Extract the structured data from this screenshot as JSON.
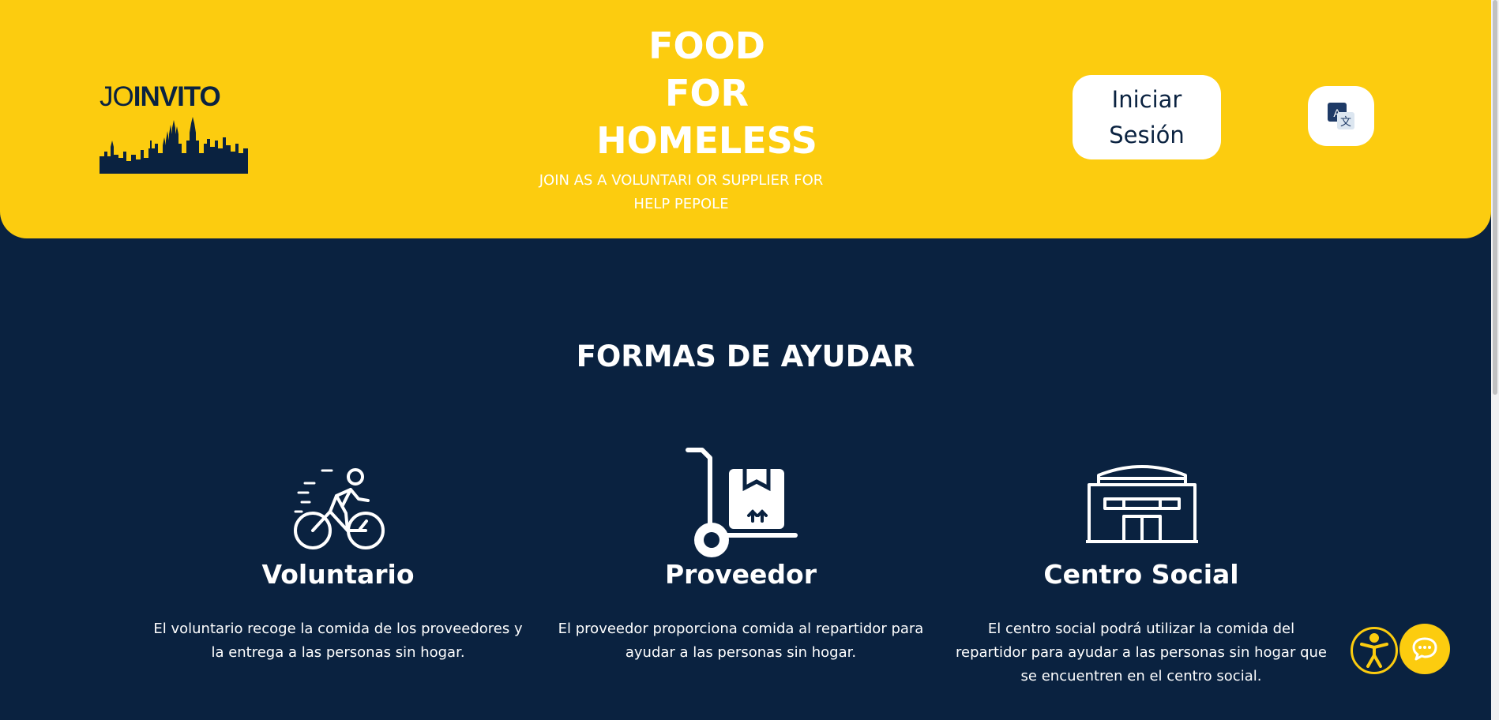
{
  "brand": {
    "logo_part1": "JO",
    "logo_part2": "INVITO"
  },
  "hero": {
    "title_line1": "FOOD",
    "title_line2": "FOR",
    "title_line3": "HOMELESS",
    "subtitle": "JOIN AS A VOLUNTARI OR SUPPLIER FOR HELP PEPOLE"
  },
  "header": {
    "login_label": "Iniciar Sesión",
    "translate_icon": "translate-icon"
  },
  "section": {
    "title": "FORMAS DE AYUDAR",
    "cards": [
      {
        "icon": "cyclist-icon",
        "title": "Voluntario",
        "text": "El voluntario recoge la comida de los proveedores y la entrega a las personas sin hogar."
      },
      {
        "icon": "hand-truck-box-icon",
        "title": "Proveedor",
        "text": "El proveedor proporciona comida al repartidor para ayudar a las personas sin hogar."
      },
      {
        "icon": "building-icon",
        "title": "Centro Social",
        "text": "El centro social podrá utilizar la comida del repartidor para ayudar a las personas sin hogar que se encuentren en el centro social."
      }
    ]
  },
  "floating": {
    "accessibility_icon": "accessibility-icon",
    "chat_icon": "chat-icon"
  },
  "colors": {
    "primary_yellow": "#fccc0f",
    "navy": "#0a2240",
    "white": "#ffffff"
  }
}
